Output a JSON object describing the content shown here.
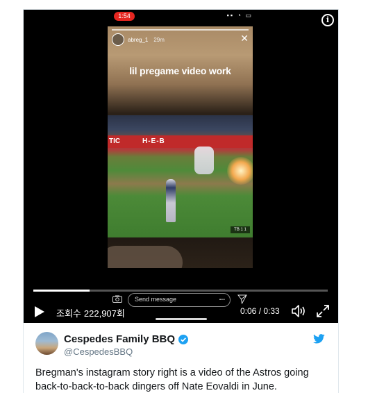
{
  "video": {
    "status_time": "1:54",
    "status_icons": "▪▪ ◔ ▭",
    "story": {
      "username": "abreg_1",
      "age": "29m",
      "caption": "lil pregame video work",
      "send_message_placeholder": "Send message",
      "more": "...",
      "banner_left": "TIC",
      "banner_right": "H-E-B",
      "scorebug": "TB 1 1"
    },
    "views_label": "조회수",
    "views_count": "222,907회",
    "time": "0:06 / 0:33",
    "progress": 0.19
  },
  "tweet": {
    "display_name": "Cespedes Family BBQ",
    "handle": "@CespedesBBQ",
    "text": "Bregman's instagram story right is a video of the Astros going back-to-back-to-back dingers off Nate Eovaldi in June.",
    "verified": true
  },
  "colors": {
    "twitter_blue": "#1da1f2",
    "live_red": "#e52620"
  }
}
